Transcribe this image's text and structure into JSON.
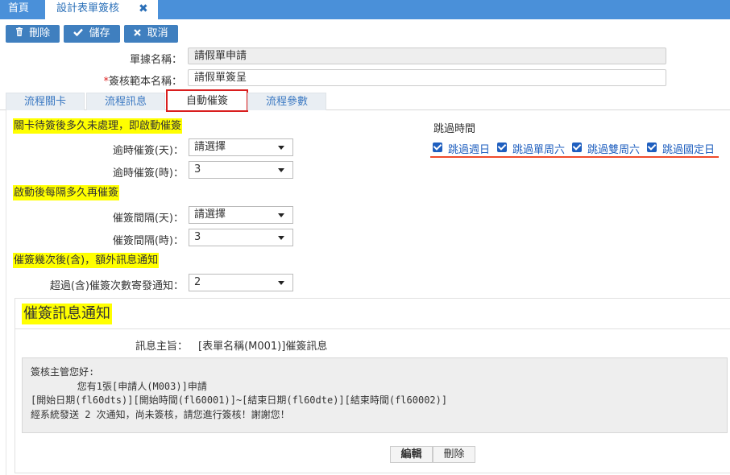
{
  "top_tabs": {
    "home": "首頁",
    "active": "設計表單簽核",
    "close": "✖"
  },
  "toolbar": {
    "delete_label": "刪除",
    "save_label": "儲存",
    "cancel_label": "取消"
  },
  "form_header": {
    "form_name_label": "單據名稱：",
    "form_name_value": "請假單申請",
    "template_name_required": "*",
    "template_name_label": "簽核範本名稱：",
    "template_name_value": "請假單簽呈"
  },
  "section_tabs": [
    "流程關卡",
    "流程訊息",
    "自動催簽",
    "流程參數"
  ],
  "active_section_tab": "自動催簽",
  "auto_remind": {
    "group1_title": "關卡待簽後多久未處理，即啟動催簽",
    "overdue_days_label": "逾時催簽(天)：",
    "overdue_days_value": "請選擇",
    "overdue_hours_label": "逾時催簽(時)：",
    "overdue_hours_value": "3",
    "group2_title": "啟動後每隔多久再催簽",
    "interval_days_label": "催簽間隔(天)：",
    "interval_days_value": "請選擇",
    "interval_hours_label": "催簽間隔(時)：",
    "interval_hours_value": "3",
    "group3_title": "催簽幾次後(含)，額外訊息通知",
    "extra_notify_label": "超過(含)催簽次數寄發通知：",
    "extra_notify_value": "2"
  },
  "skip_time": {
    "title": "跳過時間",
    "options": [
      {
        "label": "跳過週日",
        "checked": true
      },
      {
        "label": "跳過單周六",
        "checked": true
      },
      {
        "label": "跳過雙周六",
        "checked": true
      },
      {
        "label": "跳過國定日",
        "checked": true
      }
    ]
  },
  "notification": {
    "title": "催簽訊息通知",
    "subject_label": "訊息主旨：",
    "subject_value": "[表單名稱(M001)]催簽訊息",
    "body_lines": [
      "簽核主管您好:",
      "        您有1張[申請人(M003)]申請",
      "[開始日期(fl60dts)][開始時間(fl60001)]~[結束日期(fl60dte)][結束時間(fl60002)]",
      "經系統發送 2 次通知，尚未簽核，請您進行簽核！謝謝您！"
    ],
    "edit_label": "編輯",
    "delete_label": "刪除"
  },
  "colors": {
    "topbar": "#4a90d9",
    "button": "#3f7fbf",
    "highlight": "#ffff00",
    "active_tab_border": "#d91e1e",
    "checkbox": "#1f5fbf"
  }
}
